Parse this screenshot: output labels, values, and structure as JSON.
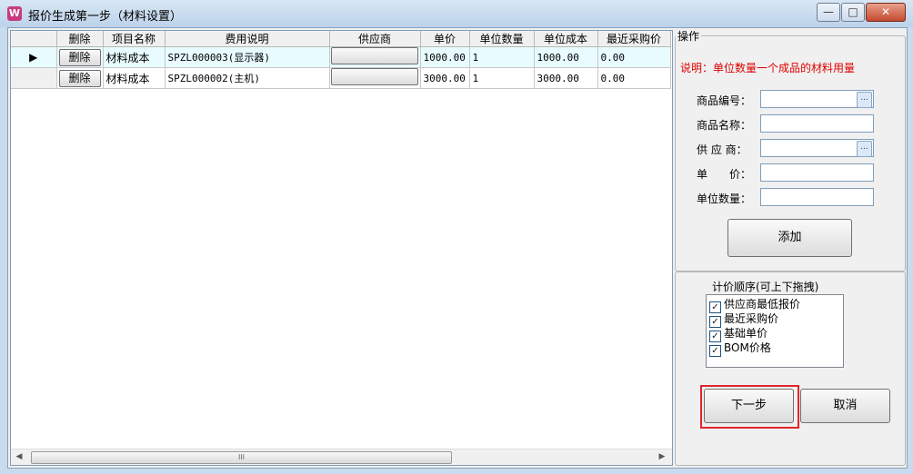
{
  "window": {
    "title": "报价生成第一步（材料设置）",
    "app_icon_glyph": "W",
    "minimize_glyph": "—",
    "maximize_glyph": "□",
    "close_glyph": "✕"
  },
  "grid": {
    "columns": [
      "删除",
      "项目名称",
      "费用说明",
      "供应商",
      "单价",
      "单位数量",
      "单位成本",
      "最近采购价"
    ],
    "rows": [
      {
        "selected": true,
        "row_marker": "▶",
        "delete_label": "删除",
        "item_name": "材料成本",
        "description": "SPZL000003(显示器)",
        "supplier": "",
        "unit_price": "1000.00",
        "unit_qty": "1",
        "unit_cost": "1000.00",
        "recent_price": "0.00"
      },
      {
        "selected": false,
        "row_marker": "",
        "delete_label": "删除",
        "item_name": "材料成本",
        "description": "SPZL000002(主机)",
        "supplier": "",
        "unit_price": "3000.00",
        "unit_qty": "1",
        "unit_cost": "3000.00",
        "recent_price": "0.00"
      }
    ],
    "scroll": {
      "left_arrow": "◀",
      "right_arrow": "▶",
      "thumb_grip": "III"
    }
  },
  "operation": {
    "group_title": "操作",
    "note": "说明：单位数量一个成品的材料用量",
    "fields": {
      "product_code": {
        "label": "商品编号：",
        "value": ""
      },
      "product_name": {
        "label": "商品名称：",
        "value": ""
      },
      "supplier": {
        "label": "供 应 商：",
        "value": ""
      },
      "unit_price": {
        "label": "单　　价：",
        "value": ""
      },
      "unit_qty": {
        "label": "单位数量：",
        "value": ""
      }
    },
    "ellipsis_label": "...",
    "add_button": "添加"
  },
  "pricing_order": {
    "group_title": "计价顺序(可上下拖拽)",
    "items": [
      {
        "label": "供应商最低报价",
        "checked": true
      },
      {
        "label": "最近采购价",
        "checked": true
      },
      {
        "label": "基础单价",
        "checked": true
      },
      {
        "label": "BOM价格",
        "checked": true
      }
    ],
    "check_glyph": "✓"
  },
  "footer": {
    "next_button": "下一步",
    "cancel_button": "取消"
  },
  "colors": {
    "note_red": "#e00000",
    "highlight_red": "#e2242b",
    "selected_row": "#e8fbff"
  }
}
